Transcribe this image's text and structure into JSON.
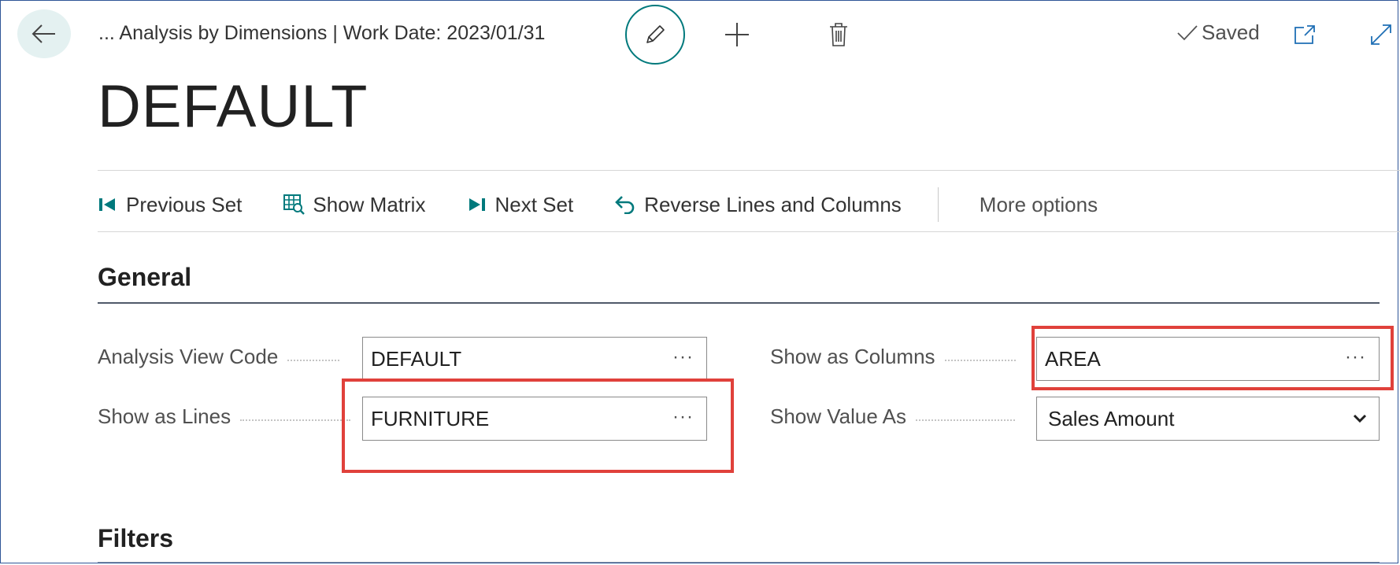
{
  "header": {
    "caption": "... Analysis by Dimensions | Work Date: 2023/01/31",
    "saved_label": "Saved"
  },
  "page": {
    "title": "DEFAULT"
  },
  "actions": [
    {
      "label": "Previous Set",
      "icon": "previous-set-icon"
    },
    {
      "label": "Show Matrix",
      "icon": "show-matrix-icon"
    },
    {
      "label": "Next Set",
      "icon": "next-set-icon"
    },
    {
      "label": "Reverse Lines and Columns",
      "icon": "undo-arrow-icon"
    }
  ],
  "more_options": "More options",
  "general": {
    "title": "General",
    "fields": {
      "analysis_view_code": {
        "label": "Analysis View Code",
        "value": "DEFAULT"
      },
      "show_as_lines": {
        "label": "Show as Lines",
        "value": "FURNITURE"
      },
      "show_as_columns": {
        "label": "Show as Columns",
        "value": "AREA"
      },
      "show_value_as": {
        "label": "Show Value As",
        "value": "Sales Amount"
      }
    },
    "lookup_glyph": "···"
  },
  "filters": {
    "title": "Filters"
  },
  "colors": {
    "accent": "#00797c",
    "highlight": "#e0413b",
    "frame": "#2f5597"
  }
}
